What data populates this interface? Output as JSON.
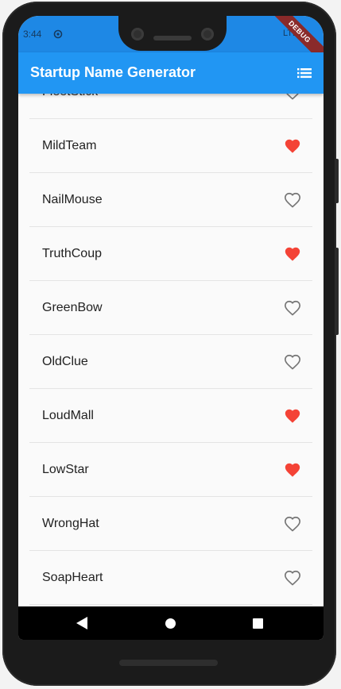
{
  "status_bar": {
    "time": "3:44",
    "network": "LTE"
  },
  "debug_banner": "DEBUG",
  "app_bar": {
    "title": "Startup Name Generator",
    "saved_list_icon": "list-icon"
  },
  "list": {
    "items": [
      {
        "label": "FleetStick",
        "saved": false
      },
      {
        "label": "MildTeam",
        "saved": true
      },
      {
        "label": "NailMouse",
        "saved": false
      },
      {
        "label": "TruthCoup",
        "saved": true
      },
      {
        "label": "GreenBow",
        "saved": false
      },
      {
        "label": "OldClue",
        "saved": false
      },
      {
        "label": "LoudMall",
        "saved": true
      },
      {
        "label": "LowStar",
        "saved": true
      },
      {
        "label": "WrongHat",
        "saved": false
      },
      {
        "label": "SoapHeart",
        "saved": false
      }
    ]
  },
  "colors": {
    "app_bar": "#2196f3",
    "status_bar": "#1e88e5",
    "saved_heart": "#f44336",
    "unsaved_heart": "#757575"
  },
  "navigation": {
    "back_icon": "back-triangle-icon",
    "home_icon": "home-circle-icon",
    "recent_icon": "recent-square-icon"
  }
}
